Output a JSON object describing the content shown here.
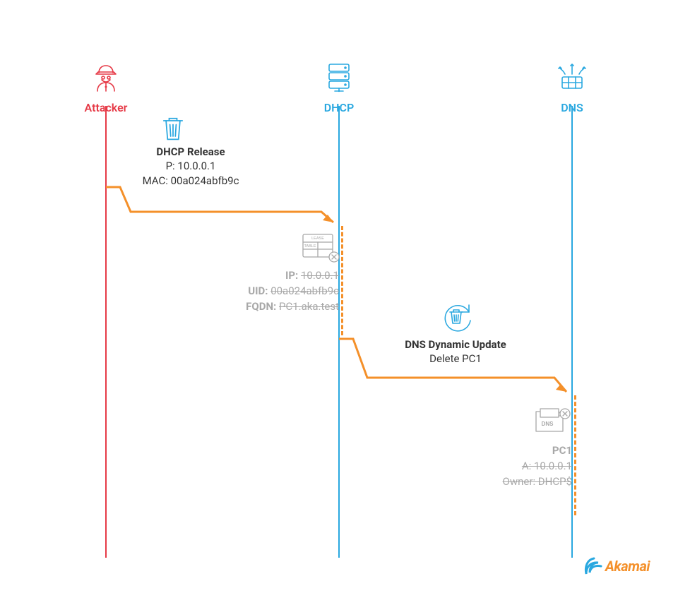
{
  "actors": {
    "attacker": "Attacker",
    "dhcp": "DHCP",
    "dns": "DNS"
  },
  "msg1": {
    "title": "DHCP Release",
    "ip_line": "P: 10.0.0.1",
    "mac_line": "MAC: 00a024abfb9c"
  },
  "lease": {
    "icon_label_top": "LEASE",
    "icon_label_bottom": "TABLE",
    "ip_key": "IP:",
    "ip_val": "10.0.0.1",
    "uid_key": "UID:",
    "uid_val": "00a024abfb9c",
    "fqdn_key": "FQDN:",
    "fqdn_val": "PC1.aka.test"
  },
  "msg2": {
    "title": "DNS Dynamic Update",
    "delete_line": "Delete PC1"
  },
  "dnsrec": {
    "icon_label": "DNS",
    "name": "PC1",
    "a_line": "A: 10.0.0.1",
    "owner_line": "Owner: DHCP$"
  },
  "logo": "Akamai",
  "colors": {
    "attacker": "#e63946",
    "blue": "#2aa8e0",
    "orange": "#f4902a",
    "gray": "#a8a8a8"
  }
}
